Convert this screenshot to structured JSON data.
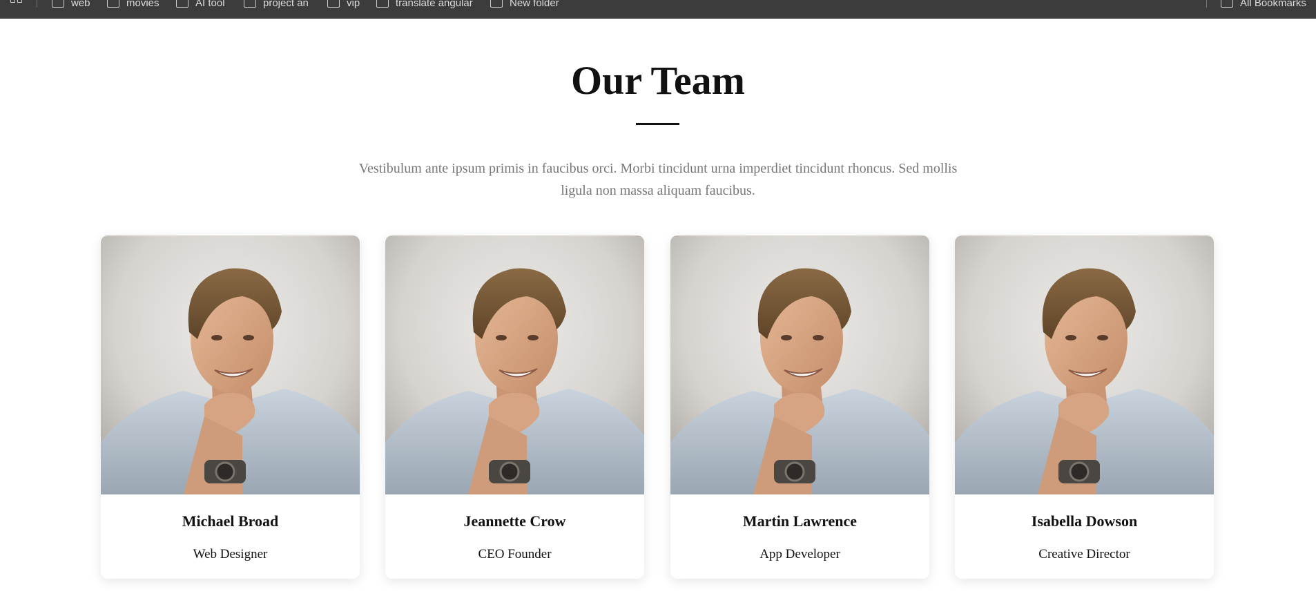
{
  "bookmarks": {
    "items": [
      {
        "label": "web"
      },
      {
        "label": "movies"
      },
      {
        "label": "AI tool"
      },
      {
        "label": "project an"
      },
      {
        "label": "vip"
      },
      {
        "label": "translate angular"
      },
      {
        "label": "New folder"
      }
    ],
    "all_bookmarks_label": "All Bookmarks"
  },
  "section": {
    "title": "Our Team",
    "description": "Vestibulum ante ipsum primis in faucibus orci. Morbi tincidunt urna imperdiet tincidunt rhoncus. Sed mollis ligula non massa aliquam faucibus."
  },
  "team": [
    {
      "name": "Michael Broad",
      "role": "Web Designer"
    },
    {
      "name": "Jeannette Crow",
      "role": "CEO Founder"
    },
    {
      "name": "Martin Lawrence",
      "role": "App Developer"
    },
    {
      "name": "Isabella Dowson",
      "role": "Creative Director"
    }
  ],
  "colors": {
    "bookmarks_bar_bg": "#3c3c3c",
    "heading": "#111111",
    "description": "#777777",
    "card_bg": "#ffffff"
  }
}
